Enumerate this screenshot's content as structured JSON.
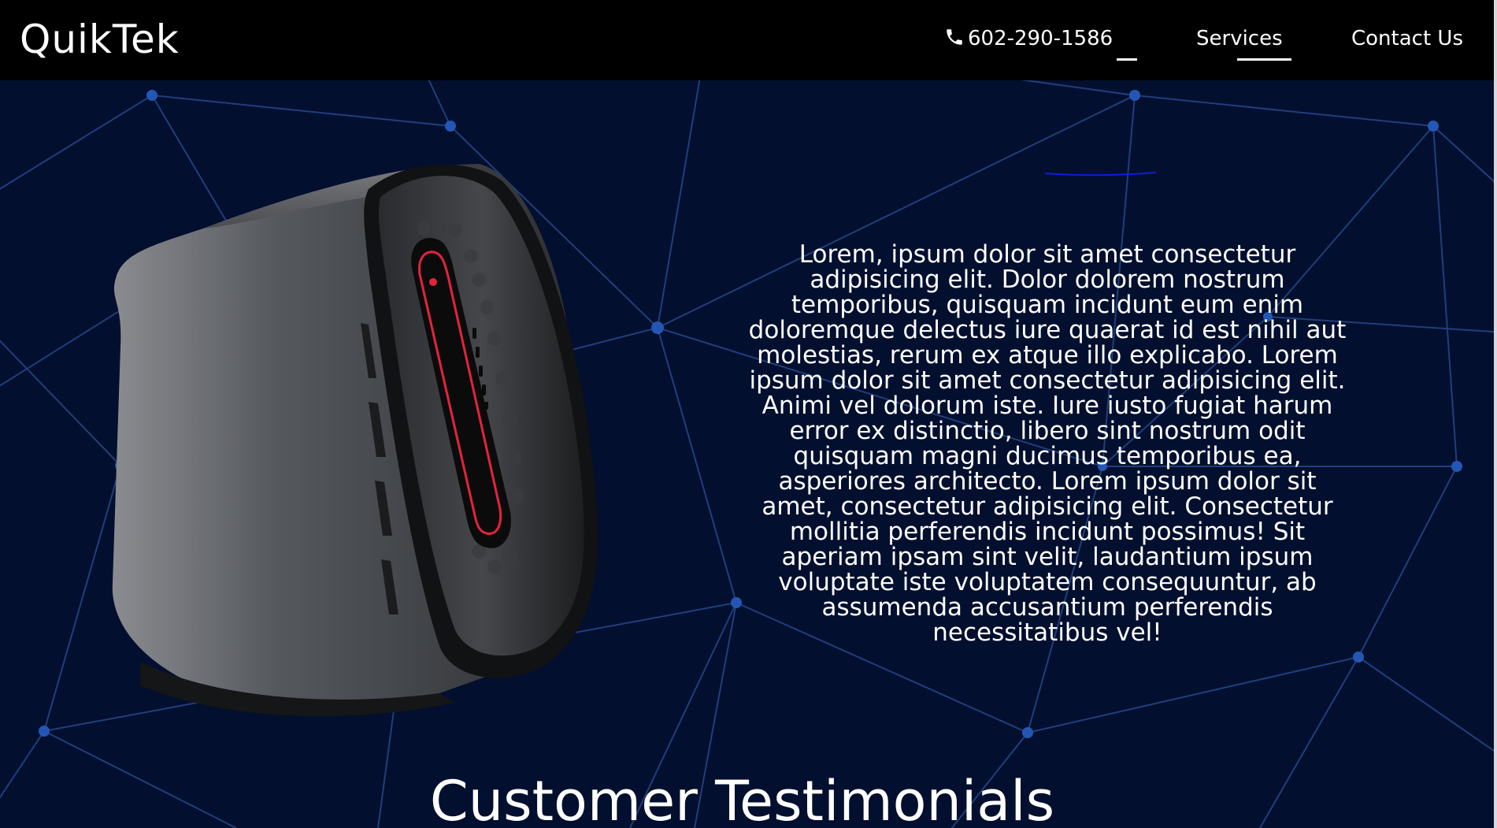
{
  "colors": {
    "navbar_bg": "#000000",
    "hero_bg": "#020f2e",
    "network_line": "#1f3f7d",
    "network_node": "#2457b5",
    "text": "#ffffff",
    "accent_stroke": "#0a1fd6",
    "led": "#e3243b"
  },
  "navbar": {
    "brand": "QuikTek",
    "phone": {
      "icon": "phone-icon",
      "number": "602-290-1586"
    },
    "services": "Services",
    "contact": "Contact Us"
  },
  "hero": {
    "image_alt": "gaming-desktop-tower",
    "paragraph": "Lorem, ipsum dolor sit amet consectetur adipisicing elit. Dolor dolorem nostrum temporibus, quisquam incidunt eum enim doloremque delectus iure quaerat id est nihil aut molestias, rerum ex atque illo explicabo. Lorem ipsum dolor sit amet consectetur adipisicing elit. Animi vel dolorum iste. Iure iusto fugiat harum error ex distinctio, libero sint nostrum odit quisquam magni ducimus temporibus ea, asperiores architecto. Lorem ipsum dolor sit amet, consectetur adipisicing elit. Consectetur mollitia perferendis incidunt possimus! Sit aperiam ipsam sint velit, laudantium ipsum voluptate iste voluptatem consequuntur, ab assumenda accusantium perferendis necessitatibus vel!"
  },
  "testimonials": {
    "title": "Customer Testimonials"
  }
}
